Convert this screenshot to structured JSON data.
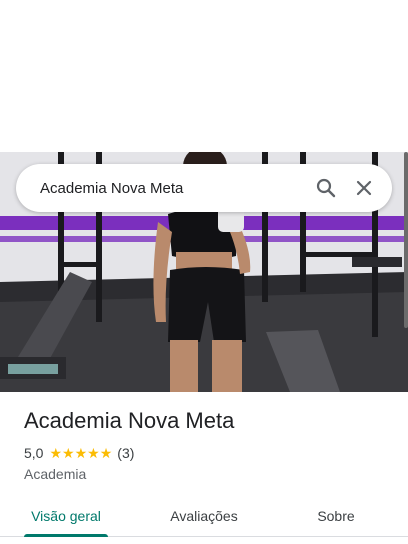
{
  "search": {
    "query": "Academia Nova Meta",
    "search_icon": "search-icon",
    "close_icon": "close-icon"
  },
  "place": {
    "name": "Academia Nova Meta",
    "rating": "5,0",
    "stars": 5,
    "review_count": "(3)",
    "category": "Academia"
  },
  "tabs": [
    {
      "label": "Visão geral",
      "active": true
    },
    {
      "label": "Avaliações",
      "active": false
    },
    {
      "label": "Sobre",
      "active": false
    }
  ],
  "colors": {
    "accent": "#00796b",
    "star": "#fbbc04",
    "gym_stripe": "#7b2fbe"
  }
}
